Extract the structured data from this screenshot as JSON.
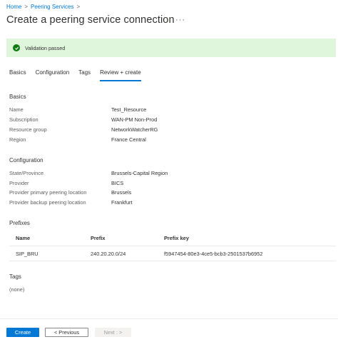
{
  "breadcrumb": {
    "home": "Home",
    "sep": ">",
    "peering": "Peering Services"
  },
  "page": {
    "title": "Create a peering service connection",
    "more": "···"
  },
  "validation": {
    "text": "Validation passed"
  },
  "tabs": [
    "Basics",
    "Configuration",
    "Tags",
    "Review + create"
  ],
  "basics": {
    "heading": "Basics",
    "rows": [
      {
        "label": "Name",
        "value": "Test_Resource"
      },
      {
        "label": "Subscription",
        "value": "WAN-PM Non-Prod"
      },
      {
        "label": "Resource group",
        "value": "NetworkWatcherRG"
      },
      {
        "label": "Region",
        "value": "France Central"
      }
    ]
  },
  "configuration": {
    "heading": "Configuration",
    "rows": [
      {
        "label": "State/Province",
        "value": "Brussels-Capital Region"
      },
      {
        "label": "Provider",
        "value": "BICS"
      },
      {
        "label": "Provider primary peering location",
        "value": "Brussels"
      },
      {
        "label": "Provider backup peering location",
        "value": "Frankfurt"
      }
    ]
  },
  "prefixes": {
    "heading": "Prefixes",
    "columns": [
      "Name",
      "Prefix",
      "Prefix key"
    ],
    "rows": [
      [
        "SIP_BRU",
        "240.20.20.0/24",
        "f5947454-80e3-4ce5-bcb3-2501537b6952"
      ]
    ]
  },
  "tags": {
    "heading": "Tags",
    "value": "(none)"
  },
  "footer": {
    "create": "Create",
    "previous": "< Previous",
    "next": "Next : >"
  },
  "colors": {
    "accent": "#0078d4",
    "success": "#107c10",
    "validation_bg": "#dff6dd"
  }
}
